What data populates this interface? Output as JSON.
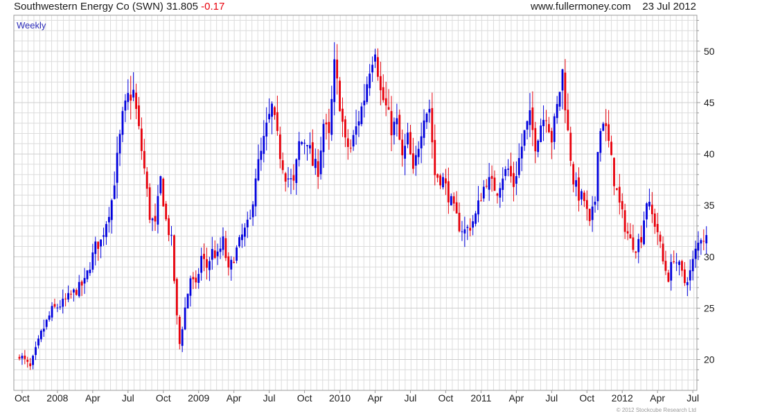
{
  "header": {
    "title": "Southwestern Energy Co (SWN) 31.805",
    "change": "-0.17",
    "site": "www.fullermoney.com",
    "date": "23 Jul 2012"
  },
  "copyright": "© 2012 Stockcube Research Ltd",
  "colors": {
    "up": "#0000dd",
    "down": "#e8000b",
    "grid": "#dcdcdc",
    "frame": "#9a9a9a"
  },
  "chart_data": {
    "type": "candlestick",
    "timeframe": "Weekly",
    "ylim": [
      17,
      53.5
    ],
    "yticks": [
      20,
      25,
      30,
      35,
      40,
      45,
      50
    ],
    "x_axis_labels": [
      {
        "label": "Oct",
        "week": 3
      },
      {
        "label": "2008",
        "week": 16
      },
      {
        "label": "Apr",
        "week": 29
      },
      {
        "label": "Jul",
        "week": 42
      },
      {
        "label": "Oct",
        "week": 55
      },
      {
        "label": "2009",
        "week": 68
      },
      {
        "label": "Apr",
        "week": 81
      },
      {
        "label": "Jul",
        "week": 94
      },
      {
        "label": "Oct",
        "week": 107
      },
      {
        "label": "2010",
        "week": 120
      },
      {
        "label": "Apr",
        "week": 133
      },
      {
        "label": "Jul",
        "week": 146
      },
      {
        "label": "Oct",
        "week": 159
      },
      {
        "label": "2011",
        "week": 172
      },
      {
        "label": "Apr",
        "week": 185
      },
      {
        "label": "Jul",
        "week": 198
      },
      {
        "label": "Oct",
        "week": 211
      },
      {
        "label": "2012",
        "week": 224
      },
      {
        "label": "Apr",
        "week": 237
      },
      {
        "label": "Jul",
        "week": 250
      }
    ],
    "close_path": [
      [
        0,
        20.5
      ],
      [
        4,
        19.2
      ],
      [
        8,
        22.5
      ],
      [
        12,
        24.8
      ],
      [
        16,
        25.5
      ],
      [
        20,
        26.5
      ],
      [
        24,
        27.5
      ],
      [
        28,
        31.0
      ],
      [
        30,
        31.5
      ],
      [
        34,
        35.5
      ],
      [
        36,
        39.5
      ],
      [
        38,
        43.5
      ],
      [
        40,
        45.5
      ],
      [
        42,
        46.0
      ],
      [
        46,
        38.5
      ],
      [
        48,
        34.0
      ],
      [
        50,
        33.0
      ],
      [
        52,
        37.5
      ],
      [
        54,
        33.5
      ],
      [
        56,
        31.5
      ],
      [
        58,
        24.0
      ],
      [
        59,
        21.5
      ],
      [
        61,
        25.0
      ],
      [
        63,
        28.0
      ],
      [
        65,
        27.0
      ],
      [
        67,
        30.0
      ],
      [
        69,
        29.0
      ],
      [
        71,
        30.5
      ],
      [
        73,
        30.0
      ],
      [
        75,
        31.5
      ],
      [
        77,
        28.5
      ],
      [
        79,
        30.0
      ],
      [
        82,
        32.0
      ],
      [
        85,
        33.5
      ],
      [
        87,
        38.0
      ],
      [
        89,
        40.0
      ],
      [
        91,
        42.5
      ],
      [
        93,
        44.5
      ],
      [
        96,
        40.0
      ],
      [
        98,
        38.0
      ],
      [
        101,
        37.0
      ],
      [
        103,
        41.0
      ],
      [
        106,
        41.5
      ],
      [
        108,
        39.0
      ],
      [
        110,
        38.5
      ],
      [
        112,
        43.0
      ],
      [
        114,
        41.5
      ],
      [
        116,
        48.5
      ],
      [
        118,
        45.0
      ],
      [
        120,
        41.0
      ],
      [
        122,
        40.5
      ],
      [
        124,
        42.5
      ],
      [
        127,
        45.5
      ],
      [
        129,
        48.5
      ],
      [
        131,
        50.5
      ],
      [
        133,
        46.0
      ],
      [
        135,
        44.5
      ],
      [
        137,
        42.5
      ],
      [
        139,
        43.0
      ],
      [
        141,
        39.5
      ],
      [
        143,
        41.5
      ],
      [
        145,
        38.0
      ],
      [
        147,
        41.0
      ],
      [
        149,
        44.0
      ],
      [
        151,
        44.5
      ],
      [
        153,
        38.0
      ],
      [
        156,
        37.5
      ],
      [
        158,
        36.0
      ],
      [
        160,
        34.5
      ],
      [
        162,
        33.0
      ],
      [
        164,
        32.5
      ],
      [
        166,
        33.0
      ],
      [
        168,
        34.0
      ],
      [
        170,
        36.0
      ],
      [
        172,
        37.5
      ],
      [
        174,
        37.0
      ],
      [
        176,
        36.5
      ],
      [
        178,
        38.0
      ],
      [
        180,
        38.5
      ],
      [
        182,
        37.0
      ],
      [
        184,
        39.5
      ],
      [
        186,
        42.0
      ],
      [
        188,
        43.5
      ],
      [
        190,
        41.0
      ],
      [
        192,
        43.0
      ],
      [
        194,
        44.0
      ],
      [
        196,
        41.5
      ],
      [
        198,
        44.5
      ],
      [
        200,
        48.0
      ],
      [
        202,
        42.0
      ],
      [
        204,
        37.5
      ],
      [
        206,
        36.0
      ],
      [
        208,
        35.5
      ],
      [
        210,
        33.0
      ],
      [
        212,
        35.5
      ],
      [
        213,
        41.0
      ],
      [
        215,
        43.5
      ],
      [
        217,
        41.0
      ],
      [
        219,
        37.5
      ],
      [
        221,
        35.0
      ],
      [
        223,
        33.0
      ],
      [
        225,
        31.5
      ],
      [
        227,
        31.0
      ],
      [
        229,
        32.0
      ],
      [
        231,
        35.5
      ],
      [
        233,
        34.0
      ],
      [
        235,
        32.5
      ],
      [
        237,
        29.5
      ],
      [
        239,
        28.0
      ],
      [
        241,
        30.0
      ],
      [
        243,
        29.0
      ],
      [
        245,
        27.5
      ],
      [
        247,
        28.5
      ],
      [
        249,
        30.5
      ],
      [
        251,
        32.0
      ],
      [
        253,
        31.8
      ]
    ]
  },
  "bounds": {
    "labels_are_y": true
  }
}
